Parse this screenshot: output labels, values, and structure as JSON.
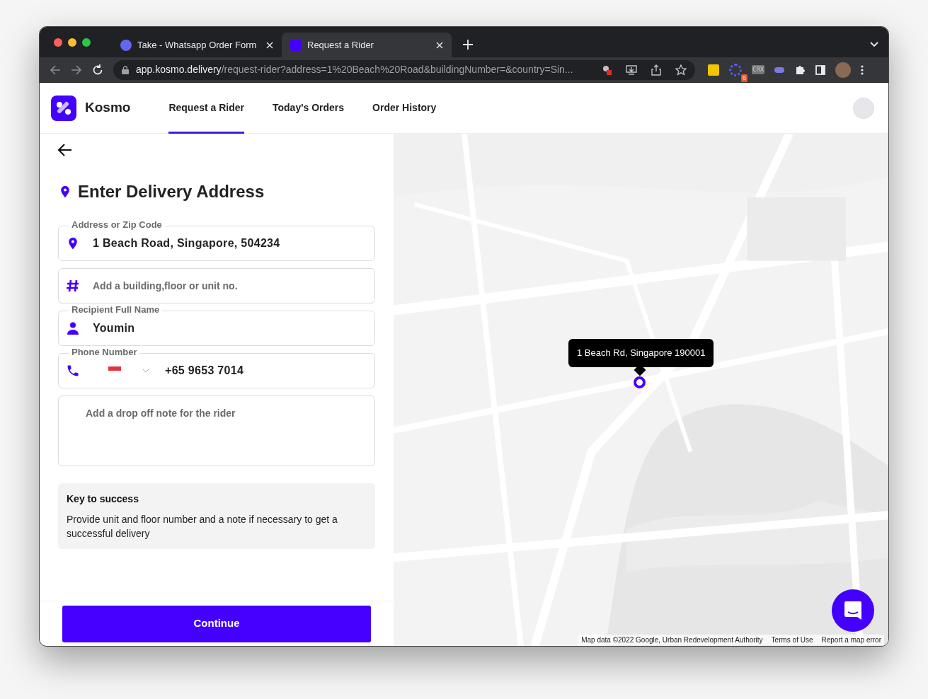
{
  "browser": {
    "tabs": [
      {
        "title": "Take - Whatsapp Order Form",
        "selected": false
      },
      {
        "title": "Request a Rider",
        "selected": true
      }
    ],
    "url": {
      "host": "app.kosmo.delivery",
      "path": "/request-rider?address=1%20Beach%20Road&buildingNumber=&country=Sin..."
    },
    "extension_badge": "6",
    "extension_label": "CRX"
  },
  "app": {
    "brand": "Kosmo",
    "nav": [
      {
        "label": "Request a Rider",
        "selected": true
      },
      {
        "label": "Today's Orders",
        "selected": false
      },
      {
        "label": "Order History",
        "selected": false
      }
    ]
  },
  "form": {
    "title": "Enter Delivery Address",
    "fields": [
      {
        "kind": "address",
        "label": "Address or Zip Code",
        "value": "1 Beach Road, Singapore, 504234"
      },
      {
        "kind": "unit",
        "placeholder": "Add a building,floor or unit no."
      },
      {
        "kind": "name",
        "label": "Recipient Full Name",
        "value": "Youmin"
      },
      {
        "kind": "phone",
        "label": "Phone Number",
        "value": "+65 9653 7014"
      },
      {
        "kind": "note",
        "placeholder": "Add a drop off note for the rider"
      }
    ],
    "tip": {
      "title": "Key to success",
      "text": "Provide unit and floor number and a note if necessary to get a successful delivery"
    },
    "continue": "Continue"
  },
  "map": {
    "tooltip": "1 Beach Rd, Singapore 190001",
    "footer": [
      "Map data ©2022 Google, Urban Redevelopment Authority",
      "Terms of Use",
      "Report a map error"
    ]
  }
}
